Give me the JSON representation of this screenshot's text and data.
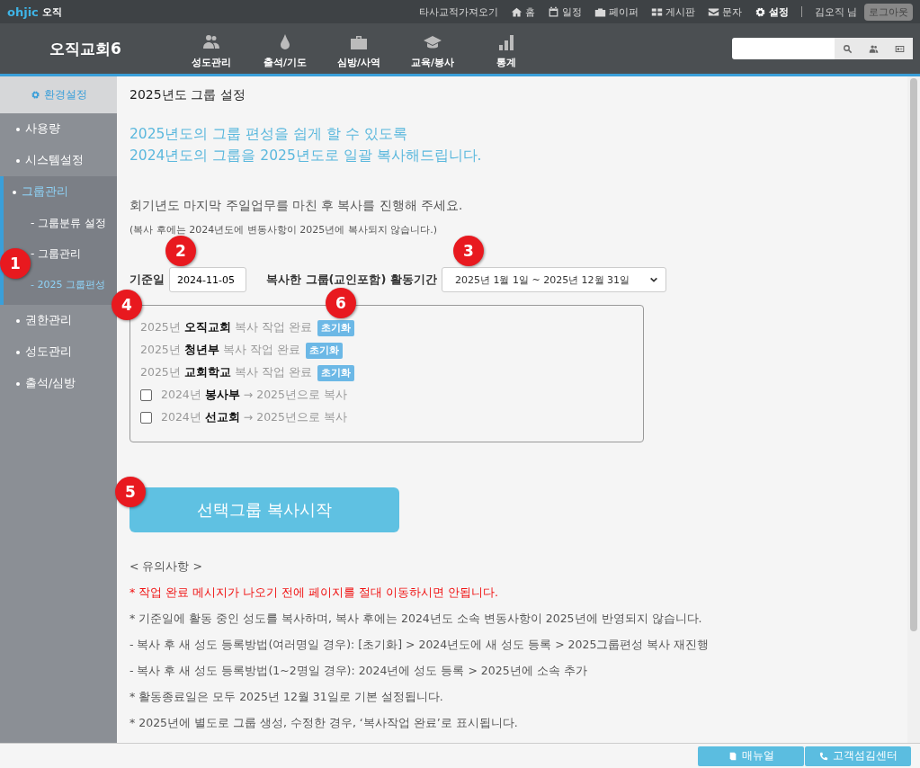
{
  "brand": {
    "logo": "ohjic",
    "name": "오직"
  },
  "top_menu": [
    {
      "label": "타사교적가져오기",
      "selected": false
    },
    {
      "label": "홈",
      "selected": false
    },
    {
      "label": "일정",
      "selected": false
    },
    {
      "label": "페이퍼",
      "selected": false
    },
    {
      "label": "게시판",
      "selected": false
    },
    {
      "label": "문자",
      "selected": false
    },
    {
      "label": "설정",
      "selected": true
    }
  ],
  "user": "김오직 님",
  "logout": "로그아웃",
  "church": "오직교회6",
  "nav": [
    {
      "label": "성도관리"
    },
    {
      "label": "출석/기도"
    },
    {
      "label": "심방/사역"
    },
    {
      "label": "교육/봉사"
    },
    {
      "label": "통계"
    }
  ],
  "sidebar": {
    "header": "환경설정",
    "items": [
      {
        "label": "사용량",
        "selected": false,
        "expanded": false
      },
      {
        "label": "시스템설정",
        "selected": false,
        "expanded": false
      },
      {
        "label": "그룹관리",
        "selected": true,
        "expanded": true,
        "children": [
          {
            "label": "- 그룹분류 설정",
            "selected": false
          },
          {
            "label": "- 그룹관리",
            "selected": false
          },
          {
            "label": "- 2025 그룹편성",
            "selected": true
          }
        ]
      },
      {
        "label": "권한관리",
        "selected": false,
        "expanded": false
      },
      {
        "label": "성도관리",
        "selected": false,
        "expanded": false
      },
      {
        "label": "출석/심방",
        "selected": false,
        "expanded": false
      }
    ]
  },
  "title": "2025년도 그룹 설정",
  "intro": [
    "2025년도의 그룹 편성을 쉽게 할 수 있도록",
    "2024년도의 그룹을 2025년도로 일괄 복사해드립니다."
  ],
  "instruction": "회기년도 마지막 주일업무를 마친 후 복사를 진행해 주세요.",
  "instruction_note": "(복사 후에는 2024년도에 변동사항이 2025년에 복사되지 않습니다.)",
  "base_date": {
    "label": "기준일",
    "value": "2024-11-05"
  },
  "period": {
    "label": "복사한 그룹(교인포함) 활동기간",
    "value": "2025년 1월 1일 ~ 2025년 12월 31일"
  },
  "groups": [
    {
      "kind": "done",
      "text": "2025년 **오직교회** 복사 작업 완료",
      "action": "초기화"
    },
    {
      "kind": "done",
      "text": "2025년 **청년부** 복사 작업 완료",
      "action": "초기화"
    },
    {
      "kind": "done",
      "text": "2025년 **교회학교** 복사 작업 완료",
      "action": "초기화"
    },
    {
      "kind": "copy",
      "text": "2024년 **봉사부** → 2025년으로 복사",
      "checked": false
    },
    {
      "kind": "copy",
      "text": "2024년 **선교회** → 2025년으로 복사",
      "checked": false
    }
  ],
  "start_button": "선택그룹 복사시작",
  "notes_title": "< 유의사항 >",
  "notes": [
    {
      "kind": "warning",
      "text": "* 작업 완료 메시지가 나오기 전에 페이지를 절대 이동하시면 안됩니다."
    },
    {
      "kind": "normal",
      "text": "* 기준일에 활동 중인 성도를 복사하며, 복사 후에는 2024년도 소속 변동사항이 2025년에 반영되지 않습니다."
    },
    {
      "kind": "normal",
      "text": "- 복사 후 새 성도 등록방법(여러명일 경우): [초기화] > 2024년도에 새 성도 등록 > 2025그룹편성 복사 재진행"
    },
    {
      "kind": "normal",
      "text": "- 복사 후 새 성도 등록방법(1~2명일 경우): 2024년에 성도 등록 > 2025년에 소속 추가"
    },
    {
      "kind": "normal",
      "text": "* 활동종료일은 모두 2025년 12월 31일로 기본 설정됩니다."
    },
    {
      "kind": "normal",
      "text": "* 2025년에 별도로 그룹 생성, 수정한 경우, ‘복사작업 완료’로 표시됩니다."
    }
  ],
  "footer": [
    {
      "label": "매뉴얼"
    },
    {
      "label": "고객섬김센터"
    }
  ],
  "markers": [
    "1",
    "2",
    "3",
    "4",
    "5",
    "6"
  ]
}
